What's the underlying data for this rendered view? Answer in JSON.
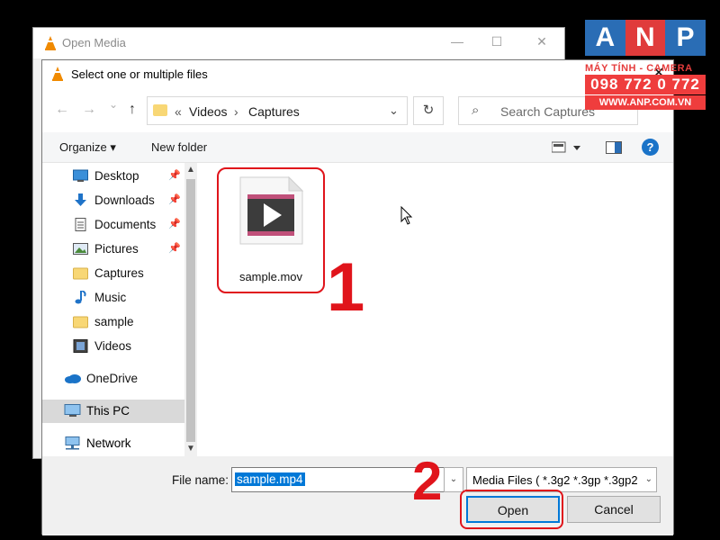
{
  "background_window": {
    "title": "Open Media",
    "min": "—",
    "max": "☐",
    "close": "✕"
  },
  "dialog": {
    "title": "Select one or multiple files",
    "close": "✕",
    "nav": {
      "back": "←",
      "forward": "→",
      "dropdown": "⌄",
      "up": "↑"
    },
    "address": {
      "prefix": "«",
      "crumb1": "Videos",
      "sep": "›",
      "crumb2": "Captures",
      "chevron": "⌄"
    },
    "refresh": "↻",
    "search_placeholder": "Search Captures",
    "toolbar": {
      "organize": "Organize ▾",
      "new_folder": "New folder",
      "help": "?"
    },
    "sidebar": [
      {
        "label": "Desktop",
        "icon": "desktop-icon",
        "pinned": true
      },
      {
        "label": "Downloads",
        "icon": "downloads-icon",
        "pinned": true
      },
      {
        "label": "Documents",
        "icon": "documents-icon",
        "pinned": true
      },
      {
        "label": "Pictures",
        "icon": "pictures-icon",
        "pinned": true
      },
      {
        "label": "Captures",
        "icon": "folder-icon",
        "pinned": false
      },
      {
        "label": "Music",
        "icon": "music-icon",
        "pinned": false
      },
      {
        "label": "sample",
        "icon": "folder-icon",
        "pinned": false
      },
      {
        "label": "Videos",
        "icon": "videos-icon",
        "pinned": false
      },
      {
        "label": "OneDrive",
        "icon": "onedrive-icon",
        "pinned": false
      },
      {
        "label": "This PC",
        "icon": "pc-icon",
        "pinned": false,
        "selected": true
      },
      {
        "label": "Network",
        "icon": "network-icon",
        "pinned": false
      }
    ],
    "files": [
      {
        "name": "sample.mov",
        "icon": "video-file-icon"
      }
    ],
    "file_name_label": "File name:",
    "file_name_value": "sample.mp4",
    "file_type": "Media Files ( *.3g2 *.3gp *.3gp2",
    "open_label": "Open",
    "cancel_label": "Cancel"
  },
  "annotations": {
    "step1": "1",
    "step2": "2"
  },
  "watermark": {
    "letters": [
      "A",
      "N",
      "P"
    ],
    "colors": [
      "#2a6db5",
      "#e03b3b",
      "#2a6db5"
    ],
    "tagline": "MÁY TÍNH - CAMERA",
    "phone": "098 772 0 772",
    "website": "WWW.ANP.COM.VN"
  }
}
